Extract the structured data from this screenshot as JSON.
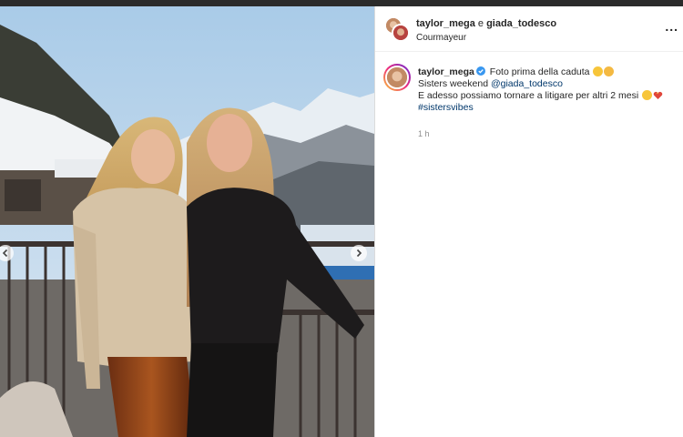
{
  "post": {
    "header": {
      "user1": "taylor_mega",
      "connector": "e",
      "user2": "giada_todesco",
      "location": "Courmayeur",
      "more_label": "..."
    },
    "caption": {
      "username": "taylor_mega",
      "line1": "Foto prima della caduta",
      "line2_text": "Sisters weekend",
      "mention": "@giada_todesco",
      "line3": "E adesso possiamo tornare a litigare per altri 2 mesi",
      "hashtag": "#sistersvibes",
      "time": "1 h"
    }
  },
  "colors": {
    "link": "#00376b",
    "verified": "#3897f0",
    "text": "#262626",
    "muted": "#8e8e8e"
  },
  "icons": {
    "prev": "chevron-left-icon",
    "next": "chevron-right-icon",
    "verified": "verified-badge-icon",
    "more": "more-options-icon"
  }
}
